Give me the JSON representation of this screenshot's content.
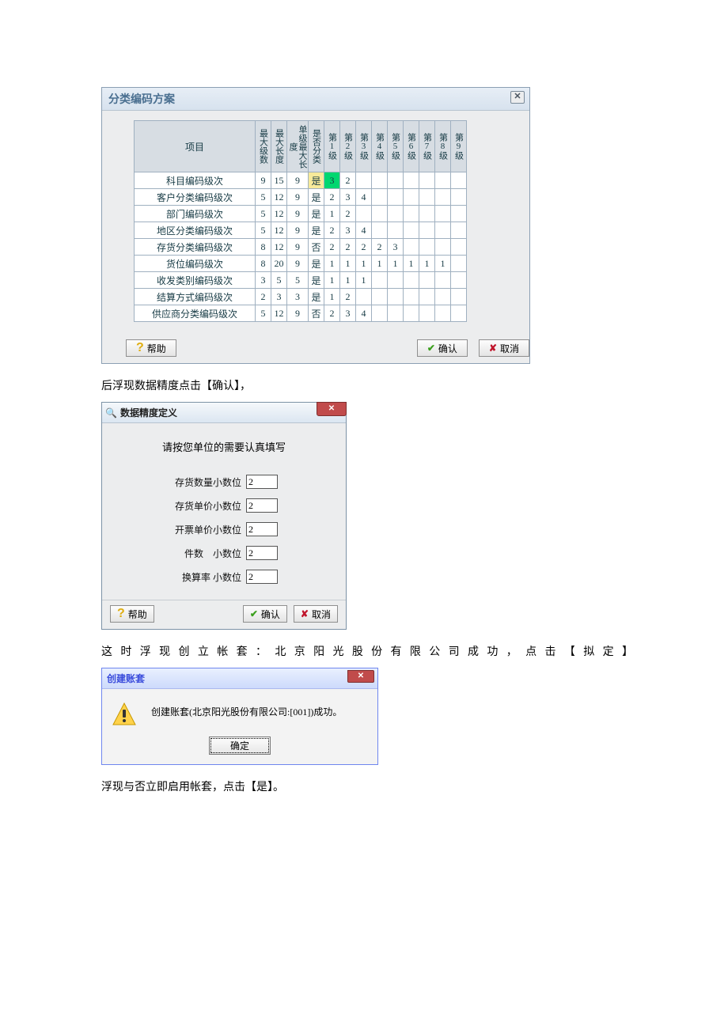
{
  "dlg1": {
    "title": "分类编码方案",
    "headers": [
      "项目",
      "最大级数",
      "最大长度",
      "单级最大长度",
      "是否分类",
      "第1级",
      "第2级",
      "第3级",
      "第4级",
      "第5级",
      "第6级",
      "第7级",
      "第8级",
      "第9级"
    ],
    "rows": [
      {
        "name": "科目编码级次",
        "maxLevels": "9",
        "maxLen": "15",
        "singleMax": "9",
        "classify": "是",
        "l1": "3",
        "l2": "2",
        "l3": "",
        "l4": "",
        "l5": "",
        "l6": "",
        "l7": "",
        "l8": "",
        "l9": "",
        "hl": 1
      },
      {
        "name": "客户分类编码级次",
        "maxLevels": "5",
        "maxLen": "12",
        "singleMax": "9",
        "classify": "是",
        "l1": "2",
        "l2": "3",
        "l3": "4",
        "l4": "",
        "l5": "",
        "l6": "",
        "l7": "",
        "l8": "",
        "l9": "",
        "hl": 0
      },
      {
        "name": "部门编码级次",
        "maxLevels": "5",
        "maxLen": "12",
        "singleMax": "9",
        "classify": "是",
        "l1": "1",
        "l2": "2",
        "l3": "",
        "l4": "",
        "l5": "",
        "l6": "",
        "l7": "",
        "l8": "",
        "l9": "",
        "hl": 0
      },
      {
        "name": "地区分类编码级次",
        "maxLevels": "5",
        "maxLen": "12",
        "singleMax": "9",
        "classify": "是",
        "l1": "2",
        "l2": "3",
        "l3": "4",
        "l4": "",
        "l5": "",
        "l6": "",
        "l7": "",
        "l8": "",
        "l9": "",
        "hl": 0
      },
      {
        "name": "存货分类编码级次",
        "maxLevels": "8",
        "maxLen": "12",
        "singleMax": "9",
        "classify": "否",
        "l1": "2",
        "l2": "2",
        "l3": "2",
        "l4": "2",
        "l5": "3",
        "l6": "",
        "l7": "",
        "l8": "",
        "l9": "",
        "hl": 0
      },
      {
        "name": "货位编码级次",
        "maxLevels": "8",
        "maxLen": "20",
        "singleMax": "9",
        "classify": "是",
        "l1": "1",
        "l2": "1",
        "l3": "1",
        "l4": "1",
        "l5": "1",
        "l6": "1",
        "l7": "1",
        "l8": "1",
        "l9": "",
        "hl": 0
      },
      {
        "name": "收发类别编码级次",
        "maxLevels": "3",
        "maxLen": "5",
        "singleMax": "5",
        "classify": "是",
        "l1": "1",
        "l2": "1",
        "l3": "1",
        "l4": "",
        "l5": "",
        "l6": "",
        "l7": "",
        "l8": "",
        "l9": "",
        "hl": 0
      },
      {
        "name": "结算方式编码级次",
        "maxLevels": "2",
        "maxLen": "3",
        "singleMax": "3",
        "classify": "是",
        "l1": "1",
        "l2": "2",
        "l3": "",
        "l4": "",
        "l5": "",
        "l6": "",
        "l7": "",
        "l8": "",
        "l9": "",
        "hl": 0
      },
      {
        "name": "供应商分类编码级次",
        "maxLevels": "5",
        "maxLen": "12",
        "singleMax": "9",
        "classify": "否",
        "l1": "2",
        "l2": "3",
        "l3": "4",
        "l4": "",
        "l5": "",
        "l6": "",
        "l7": "",
        "l8": "",
        "l9": "",
        "hl": 0
      }
    ],
    "btn_help": "帮助",
    "btn_ok": "确认",
    "btn_cancel": "取消"
  },
  "para1": "后浮现数据精度点击【确认】，",
  "dlg2": {
    "title": "数据精度定义",
    "intro": "请按您单位的需要认真填写",
    "fields": [
      {
        "label": "存货数量小数位",
        "value": "2"
      },
      {
        "label": "存货单价小数位",
        "value": "2"
      },
      {
        "label": "开票单价小数位",
        "value": "2"
      },
      {
        "label": "件数　小数位",
        "value": "2"
      },
      {
        "label": "换算率 小数位",
        "value": "2"
      }
    ],
    "btn_help": "帮助",
    "btn_ok": "确认",
    "btn_cancel": "取消"
  },
  "para2": "这时浮现创立帐套：北京阳光股份有限公司成功，点击【拟定】",
  "dlg3": {
    "title": "创建账套",
    "msg": "创建账套(北京阳光股份有限公司:[001])成功。",
    "btn_ok": "确定"
  },
  "para3": "浮现与否立即启用帐套，点击【是】。"
}
